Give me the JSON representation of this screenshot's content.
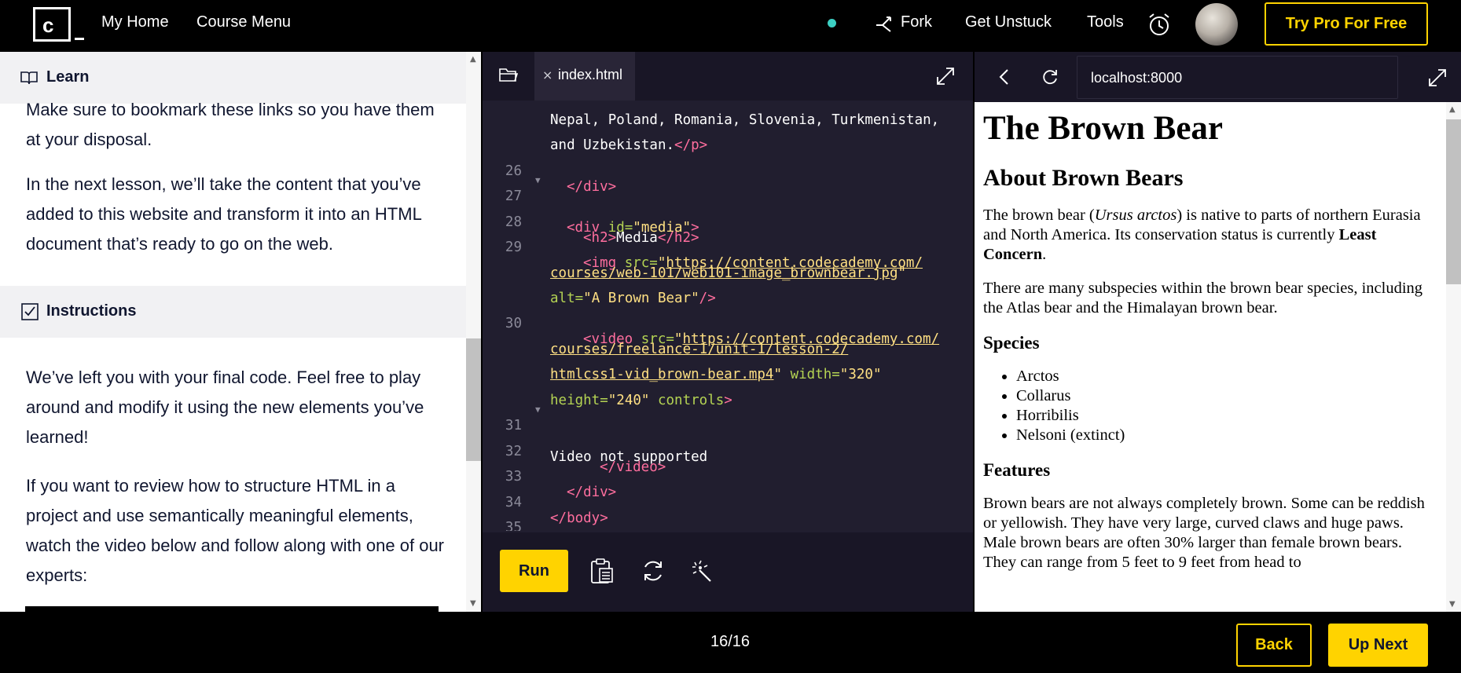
{
  "nav": {
    "logo_text": "c",
    "my_home": "My Home",
    "course_menu": "Course Menu",
    "fork": "Fork",
    "get_unstuck": "Get Unstuck",
    "tools": "Tools",
    "try_pro": "Try Pro For Free",
    "status_dot_color": "#3cd0c3"
  },
  "lesson": {
    "learn_label": "Learn",
    "para1": "Make sure to bookmark these links so you have them at your disposal.",
    "para2": "In the next lesson, we’ll take the content that you’ve added to this website and transform it into an HTML document that’s ready to go on the web.",
    "instructions_label": "Instructions",
    "para3": "We’ve left you with your final code. Feel free to play around and modify it using the new elements you’ve learned!",
    "para4": "If you want to review how to structure HTML in a project and use semantically meaningful elements, watch the video below and follow along with one of our experts:"
  },
  "editor": {
    "tab_close": "×",
    "file_name": "index.html",
    "lines": [
      {
        "n": "",
        "t": "Nepal, Poland, Romania, Slovenia, Turkmenistan,"
      },
      {
        "n": "",
        "t1": "and Uzbekistan.",
        "t2": "</p>"
      },
      {
        "n": "26",
        "t": "</div>"
      },
      {
        "n": "27",
        "open": "<div ",
        "attr": "id=",
        "val": "\"media\"",
        "close": ">"
      },
      {
        "n": "28",
        "o": "<h2>",
        "txt": "Media",
        "c": "</h2>"
      },
      {
        "n": "29",
        "open": "<img ",
        "attr": "src=",
        "q": "\"",
        "url": "https://content.codecademy.com/"
      },
      {
        "n": "",
        "url": "courses/web-101/web101-image_brownbear.jpg",
        "q": "\""
      },
      {
        "n": "",
        "attr": "alt=",
        "val": "\"A Brown Bear\"",
        "close": "/>"
      },
      {
        "n": "30",
        "open": "<video ",
        "attr": "src=",
        "q": "\"",
        "url": "https://content.codecademy.com/"
      },
      {
        "n": "",
        "url": "courses/freelance-1/unit-1/lesson-2/"
      },
      {
        "n": "",
        "url": "htmlcss1-vid_brown-bear.mp4",
        "q": "\"",
        "attr2": " width=",
        "val2": "\"320\""
      },
      {
        "n": "",
        "attr": "height=",
        "val": "\"240\"",
        "attr2": " controls",
        "close": ">"
      },
      {
        "n": "31",
        "txt": "Video not supported"
      },
      {
        "n": "32",
        "t": "</video>"
      },
      {
        "n": "33",
        "t": "</div>"
      },
      {
        "n": "34",
        "t": "</body>"
      },
      {
        "n": "35",
        "t": ""
      }
    ],
    "run_label": "Run",
    "colors": {
      "tag": "#ff6e9e",
      "attr": "#b4d353",
      "value": "#ffe083"
    }
  },
  "browser": {
    "url": "localhost:8000",
    "h1": "The Brown Bear",
    "h2": "About Brown Bears",
    "p1_pre": "The brown bear (",
    "p1_em": "Ursus arctos",
    "p1_mid": ") is native to parts of northern Eurasia and North America. Its conservation status is currently ",
    "p1_strong": "Least Concern",
    "p1_end": ".",
    "p2": "There are many subspecies within the brown bear species, including the Atlas bear and the Himalayan brown bear.",
    "h3_species": "Species",
    "species": [
      "Arctos",
      "Collarus",
      "Horribilis",
      "Nelsoni (extinct)"
    ],
    "h3_features": "Features",
    "p3": "Brown bears are not always completely brown. Some can be reddish or yellowish. They have very large, curved claws and huge paws. Male brown bears are often 30% larger than female brown bears. They can range from 5 feet to 9 feet from head to"
  },
  "footer": {
    "progress": "16/16",
    "back": "Back",
    "up_next": "Up Next"
  },
  "icons": [
    "logo-icon",
    "fork-icon",
    "alarm-icon",
    "book-icon",
    "checkbox-icon",
    "folder-icon",
    "expand-icon",
    "copy-icon",
    "reset-icon",
    "magic-wand-icon",
    "back-arrow-icon",
    "reload-icon"
  ]
}
